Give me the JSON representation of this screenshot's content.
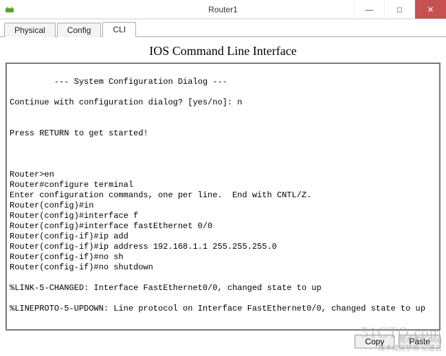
{
  "window": {
    "title": "Router1",
    "minimize": "—",
    "maximize": "□",
    "close": "✕"
  },
  "tabs": {
    "physical": "Physical",
    "config": "Config",
    "cli": "CLI"
  },
  "heading": "IOS Command Line Interface",
  "terminal_text": "\n         --- System Configuration Dialog ---\n\nContinue with configuration dialog? [yes/no]: n\n\n\nPress RETURN to get started!\n\n\n\nRouter>en\nRouter#configure terminal\nEnter configuration commands, one per line.  End with CNTL/Z.\nRouter(config)#in\nRouter(config)#interface f\nRouter(config)#interface fastEthernet 0/0\nRouter(config-if)#ip add\nRouter(config-if)#ip address 192.168.1.1 255.255.255.0\nRouter(config-if)#no sh\nRouter(config-if)#no shutdown\n\n%LINK-5-CHANGED: Interface FastEthernet0/0, changed state to up\n\n%LINEPROTO-5-UPDOWN: Line protocol on Interface FastEthernet0/0, changed state to up",
  "buttons": {
    "copy": "Copy",
    "paste": "Paste"
  },
  "watermark": {
    "line1": "51CTO.com",
    "line2": "技术博客    Blog",
    "line3": "技术成就梦想 亿速云"
  }
}
